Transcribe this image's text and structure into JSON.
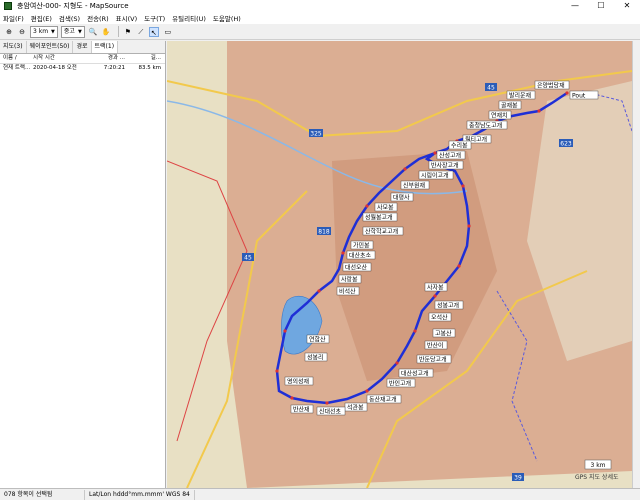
{
  "window": {
    "title": "충암여산-000- 지형도 - MapSource",
    "controls": [
      "—",
      "☐",
      "✕"
    ]
  },
  "menu": [
    "파일(F)",
    "편집(E)",
    "검색(S)",
    "전송(R)",
    "표시(V)",
    "도구(T)",
    "유틸리티(U)",
    "도움말(H)"
  ],
  "toolbar": {
    "distance_value": "3 km",
    "detail_value": "중고"
  },
  "tabs": [
    "지도(3)",
    "웨이포인트(50)",
    "경로",
    "트랙(1)"
  ],
  "track_list": {
    "headers": [
      "이름",
      "/",
      "시작 시간",
      "경과 ...",
      "길..."
    ],
    "rows": [
      {
        "name": "현재 트랙...",
        "start": "2020-04-18 오전 ...",
        "elapsed": "7:20:21",
        "length": "83.5 km"
      }
    ]
  },
  "map": {
    "roads": [
      "45",
      "325",
      "818",
      "45",
      "623",
      "39"
    ],
    "waypoints": [
      "은양범당재",
      "발리운재",
      "골재봉",
      "연재치",
      "충청남도고개",
      "월티고개",
      "수리봉",
      "산성고개",
      "반사장고개",
      "시림이고개",
      "신부원재",
      "대평사",
      "사모봉",
      "성월봉고개",
      "산학학교고개",
      "가민봉",
      "대산초소",
      "대선오산",
      "사랑봉",
      "비석산",
      "사자봉",
      "성봉고개",
      "오석산",
      "고봉산",
      "반산이",
      "반둔당고개",
      "대산성고개",
      "반인고개",
      "동산재고개",
      "석관봉",
      "신대선초",
      "반산재",
      "영의성재",
      "연합산",
      "성봉리",
      "Pout"
    ],
    "scale_label": "3 km",
    "watermark": "GPS 지도 상세도"
  },
  "status": {
    "selection": "078 항목이 선택됨",
    "coords": "Lat/Lon hddd°mm.mmm' WGS 84"
  },
  "colors": {
    "track": "#1f2fd6",
    "terrain": "#d9a98e",
    "lowland": "#e6dcc0",
    "road": "#f2c94c"
  }
}
